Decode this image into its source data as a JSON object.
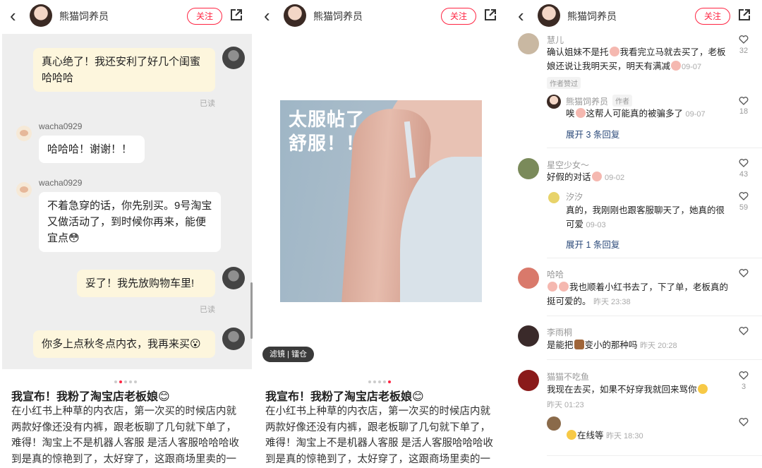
{
  "header": {
    "username": "熊猫饲养员",
    "follow_label": "关注"
  },
  "panel1": {
    "messages": [
      {
        "text": "真心绝了！我还安利了好几个闺蜜哈哈哈",
        "read": "已读"
      },
      {
        "name": "wacha0929",
        "text": "哈哈哈！谢谢！！"
      },
      {
        "name": "wacha0929",
        "text": "不着急穿的话，你先别买。9号淘宝又做活动了，到时候你再来，能便宜点😳"
      },
      {
        "text": "妥了！我先放购物车里!",
        "read": "已读"
      },
      {
        "text": "你多上点秋冬点内衣，我再来买😮"
      }
    ]
  },
  "panel2": {
    "photo_text_line1": "太服帖了",
    "photo_text_line2": "舒服！！",
    "filter_label": "滤镜 | 镭仓"
  },
  "post": {
    "title": "我宣布！我粉了淘宝店老板娘😊",
    "body": "在小红书上种草的内衣店，第一次买的时候店内就两款好像还没有内裤，跟老板聊了几句就下单了，难得！淘宝上不是机器人客服 是活人客服哈哈哈收到是真的惊艳到了，太好穿了，这跟商场里卖的一"
  },
  "comments": {
    "c1": {
      "name": "慧儿",
      "text": "确认姐妹不是托",
      "text2": "我看完立马就去买了，老板娘还说让我明天买，明天有满减",
      "date": "09-07",
      "likes": "32",
      "tag": "作者赞过"
    },
    "r1": {
      "name": "熊猫饲养员",
      "badge": "作者",
      "text": "唉",
      "text2": "这帮人可能真的被骗多了",
      "date": "09-07",
      "likes": "18",
      "expand": "展开 3 条回复"
    },
    "c2": {
      "name": "星空少女～",
      "text": "好假的对话",
      "date": "09-02",
      "likes": "43"
    },
    "r2": {
      "name": "汐汐",
      "text": "真的，我刚刚也跟客服聊天了，她真的很可爱",
      "date": "09-03",
      "likes": "59",
      "expand": "展开 1 条回复"
    },
    "c3": {
      "name": "哈哈",
      "text": "我也顺着小红书去了，下了单，老板真的挺可爱的。",
      "date": "昨天 23:38"
    },
    "c4": {
      "name": "李雨桐",
      "text": "是能把",
      "text2": "变小的那种吗",
      "date": "昨天 20:28"
    },
    "c5": {
      "name": "猫猫不吃鱼",
      "text": "我现在去买，如果不好穿我就回来骂你",
      "date": "昨天 01:23",
      "likes": "3"
    },
    "r5": {
      "text": "在线等",
      "date": "昨天 18:30"
    }
  },
  "colors": {
    "accent": "#ff2442",
    "chat_bg": "#eeeeee",
    "bubble_self": "#fdf6dd"
  }
}
